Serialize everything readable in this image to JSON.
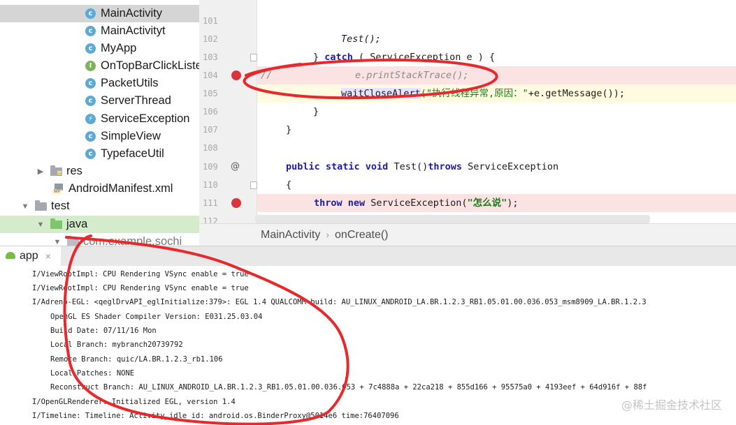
{
  "project_tree": {
    "items": [
      {
        "label": "MainActivity",
        "icon": "class-icon",
        "glyph": "c"
      },
      {
        "label": "MainActivityt",
        "icon": "class-icon",
        "glyph": "c"
      },
      {
        "label": "MyApp",
        "icon": "class-icon",
        "glyph": "c"
      },
      {
        "label": "OnTopBarClickListe",
        "icon": "interface-icon",
        "glyph": "I"
      },
      {
        "label": "PacketUtils",
        "icon": "class-icon",
        "glyph": "c"
      },
      {
        "label": "ServerThread",
        "icon": "class-icon",
        "glyph": "c"
      },
      {
        "label": "ServiceException",
        "icon": "exception-class-icon",
        "glyph": "⚡"
      },
      {
        "label": "SimpleView",
        "icon": "class-icon",
        "glyph": "c"
      },
      {
        "label": "TypefaceUtil",
        "icon": "class-icon",
        "glyph": "c"
      },
      {
        "label": "res",
        "icon": "res-folder-icon"
      },
      {
        "label": "AndroidManifest.xml",
        "icon": "manifest-file-icon",
        "badge": "MF"
      },
      {
        "label": "test",
        "icon": "folder-icon"
      },
      {
        "label": "java",
        "icon": "java-folder-icon"
      },
      {
        "label": "com.example.sochi",
        "icon": "package-icon"
      }
    ]
  },
  "editor": {
    "lines": [
      {
        "num": "101"
      },
      {
        "num": "102",
        "code": "Test();"
      },
      {
        "num": "103",
        "kw": "catch",
        "rest": " ( ServiceException e ) {"
      },
      {
        "num": "104",
        "comment": "//",
        "call": "e.printStackTrace();"
      },
      {
        "num": "105",
        "method": "waitCloseAlert",
        "string": "(\"执行线程异常,原因：\"",
        "rest": "+e.getMessage());"
      },
      {
        "num": "106",
        "code": "}"
      },
      {
        "num": "107",
        "code": "}"
      },
      {
        "num": "108"
      },
      {
        "num": "109",
        "modifiers": "public static void",
        "name": " Test()",
        "throws": "throws",
        "rest": " ServiceException",
        "marker": "@"
      },
      {
        "num": "110",
        "code": "{"
      },
      {
        "num": "111",
        "kw1": "throw",
        "kw2": "new",
        "rest": " ServiceException(",
        "string": "\"怎么说\"",
        "end": ");"
      },
      {
        "num": "112"
      }
    ]
  },
  "breadcrumb": {
    "file": "MainActivity",
    "separator": "›",
    "method": "onCreate()"
  },
  "run_panel": {
    "tab_label": "app",
    "close_glyph": "×",
    "log_lines": [
      "I/ViewRootImpl: CPU Rendering VSync enable = true",
      "I/ViewRootImpl: CPU Rendering VSync enable = true",
      "I/Adreno-EGL: <qeglDrvAPI_eglInitialize:379>: EGL 1.4 QUALCOMM build: AU_LINUX_ANDROID_LA.BR.1.2.3_RB1.05.01.00.036.053_msm8909_LA.BR.1.2.3",
      "OpenGL ES Shader Compiler Version: E031.25.03.04",
      "Build Date: 07/11/16 Mon",
      "Local Branch: mybranch20739792",
      "Remote Branch: quic/LA.BR.1.2.3_rb1.106",
      "Local Patches: NONE",
      "Reconstruct Branch: AU_LINUX_ANDROID_LA.BR.1.2.3_RB1.05.01.00.036.053 + 7c4888a + 22ca218 + 855d166 + 95575a0 + 4193eef + 64d916f + 88f",
      "I/OpenGLRenderer: Initialized EGL, version 1.4",
      "I/Timeline: Timeline: Activity_idle id: android.os.BinderProxy@5014e6 time:76407096"
    ]
  },
  "watermark": "@稀土掘金技术社区",
  "colors": {
    "annotation": "#e8282b",
    "breakpoint": "#d9333f",
    "keyword": "#1f1c9c",
    "string": "#1a7a1a"
  }
}
